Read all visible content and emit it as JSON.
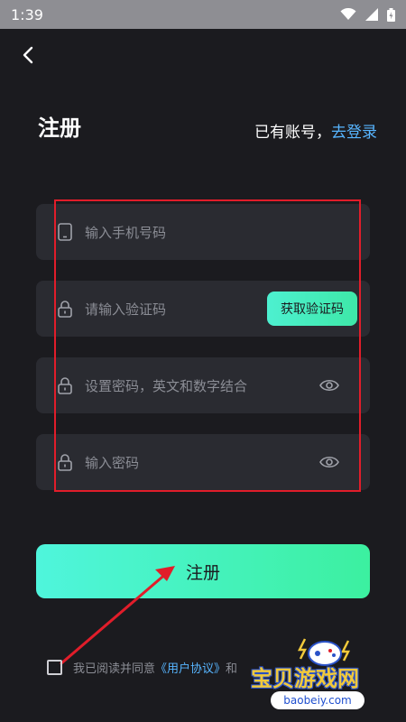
{
  "status_bar": {
    "time": "1:39"
  },
  "header": {
    "title": "注册",
    "login_prompt": "已有账号，",
    "login_link": "去登录"
  },
  "form": {
    "phone_placeholder": "输入手机号码",
    "code_placeholder": "请输入验证码",
    "get_code_label": "获取验证码",
    "password_placeholder": "设置密码，英文和数字结合",
    "confirm_password_placeholder": "输入密码"
  },
  "register_button": {
    "label": "注册"
  },
  "agreement": {
    "prefix": "我已阅读并同意",
    "user_agreement": "《用户协议》",
    "and": "和"
  },
  "watermark": {
    "text": "宝贝游戏网",
    "url": "baobeiy.com"
  },
  "colors": {
    "accent": "#3ef0b0",
    "link": "#57b5ff",
    "annotation": "#e11d2a",
    "background": "#1b1b1f"
  }
}
